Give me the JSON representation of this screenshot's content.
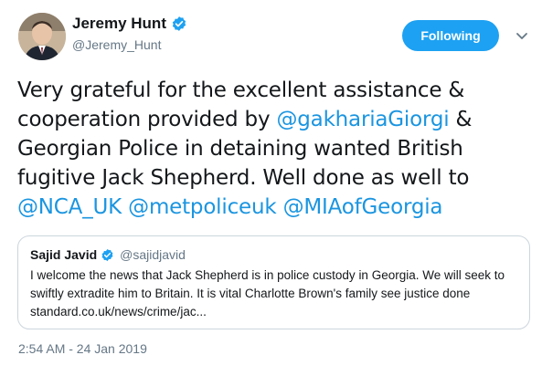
{
  "tweet": {
    "author": {
      "name": "Jeremy Hunt",
      "handle": "@Jeremy_Hunt",
      "verified": true
    },
    "follow_button_label": "Following",
    "text_lines": [
      [
        {
          "t": "Very grateful for the excellent assistance &"
        }
      ],
      [
        {
          "t": "cooperation provided by "
        },
        {
          "t": "@gakhariaGiorgi",
          "mention": true
        },
        {
          "t": " &"
        }
      ],
      [
        {
          "t": "Georgian Police in detaining wanted British"
        }
      ],
      [
        {
          "t": "fugitive Jack Shepherd. Well done as well to"
        }
      ],
      [
        {
          "t": "@NCA_UK",
          "mention": true
        },
        {
          "t": " "
        },
        {
          "t": "@metpoliceuk",
          "mention": true
        },
        {
          "t": " "
        },
        {
          "t": "@MIAofGeorgia",
          "mention": true
        }
      ]
    ],
    "quoted": {
      "name": "Sajid Javid",
      "handle": "@sajidjavid",
      "verified": true,
      "lines": [
        "I welcome the news that Jack Shepherd is in police custody in Georgia. We will seek to",
        "swiftly extradite him to Britain. It is vital Charlotte Brown's family see justice done",
        "standard.co.uk/news/crime/jac..."
      ]
    },
    "timestamp": "2:54 AM - 24 Jan 2019"
  },
  "colors": {
    "accent": "#1da1f2",
    "mention": "#1b95e0",
    "secondary_text": "#657786",
    "border": "#ccd6dd"
  },
  "icons": {
    "verified": "verified-badge-icon",
    "caret": "chevron-down-icon"
  }
}
